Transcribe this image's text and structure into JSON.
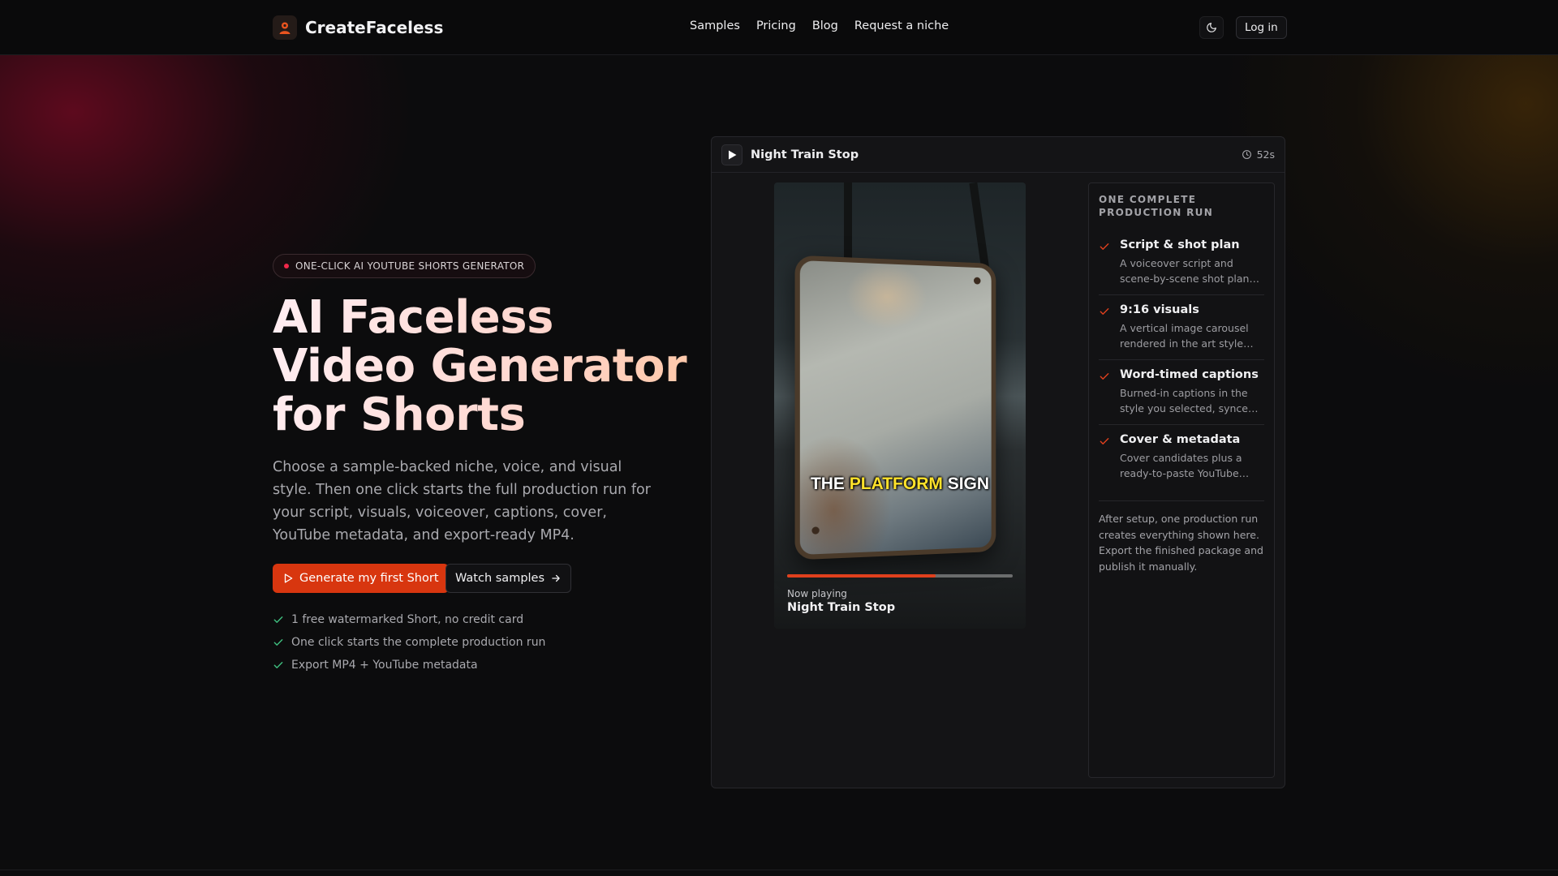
{
  "brand": {
    "name": "CreateFaceless",
    "logo_icon": "faceless-avatar-icon",
    "accent": "#d8360f"
  },
  "nav": {
    "items": [
      "Samples",
      "Pricing",
      "Blog",
      "Request a niche"
    ]
  },
  "header": {
    "theme_icon": "moon-icon",
    "login_label": "Log in"
  },
  "hero": {
    "badge": "ONE-CLICK AI YOUTUBE SHORTS GENERATOR",
    "title_lines": [
      "AI Faceless",
      "Video Generator",
      "for Shorts"
    ],
    "subtitle": "Choose a sample-backed niche, voice, and visual style. Then one click starts the full production run for your script, visuals, voiceover, captions, cover, YouTube metadata, and export-ready MP4.",
    "primary_cta": "Generate my first Short",
    "secondary_cta": "Watch samples",
    "checks": [
      "1 free watermarked Short, no credit card",
      "One click starts the complete production run",
      "Export MP4 + YouTube metadata"
    ]
  },
  "preview": {
    "title": "Night Train Stop",
    "duration": "52s",
    "caption": {
      "before": "THE ",
      "highlight": "PLATFORM",
      "after": " SIGN"
    },
    "progress": 0.66,
    "now_playing_label": "Now playing",
    "now_playing_title": "Night Train Stop",
    "side_title": "ONE COMPLETE PRODUCTION RUN",
    "steps": [
      {
        "title": "Script & shot plan",
        "desc": "A voiceover script and scene-by-scene shot plan generated..."
      },
      {
        "title": "9:16 visuals",
        "desc": "A vertical image carousel rendered in the art style you..."
      },
      {
        "title": "Word-timed captions",
        "desc": "Burned-in captions in the style you selected, synced word by..."
      },
      {
        "title": "Cover & metadata",
        "desc": "Cover candidates plus a ready-to-paste YouTube title,..."
      }
    ],
    "note": "After setup, one production run creates everything shown here. Export the finished package and publish it manually."
  }
}
